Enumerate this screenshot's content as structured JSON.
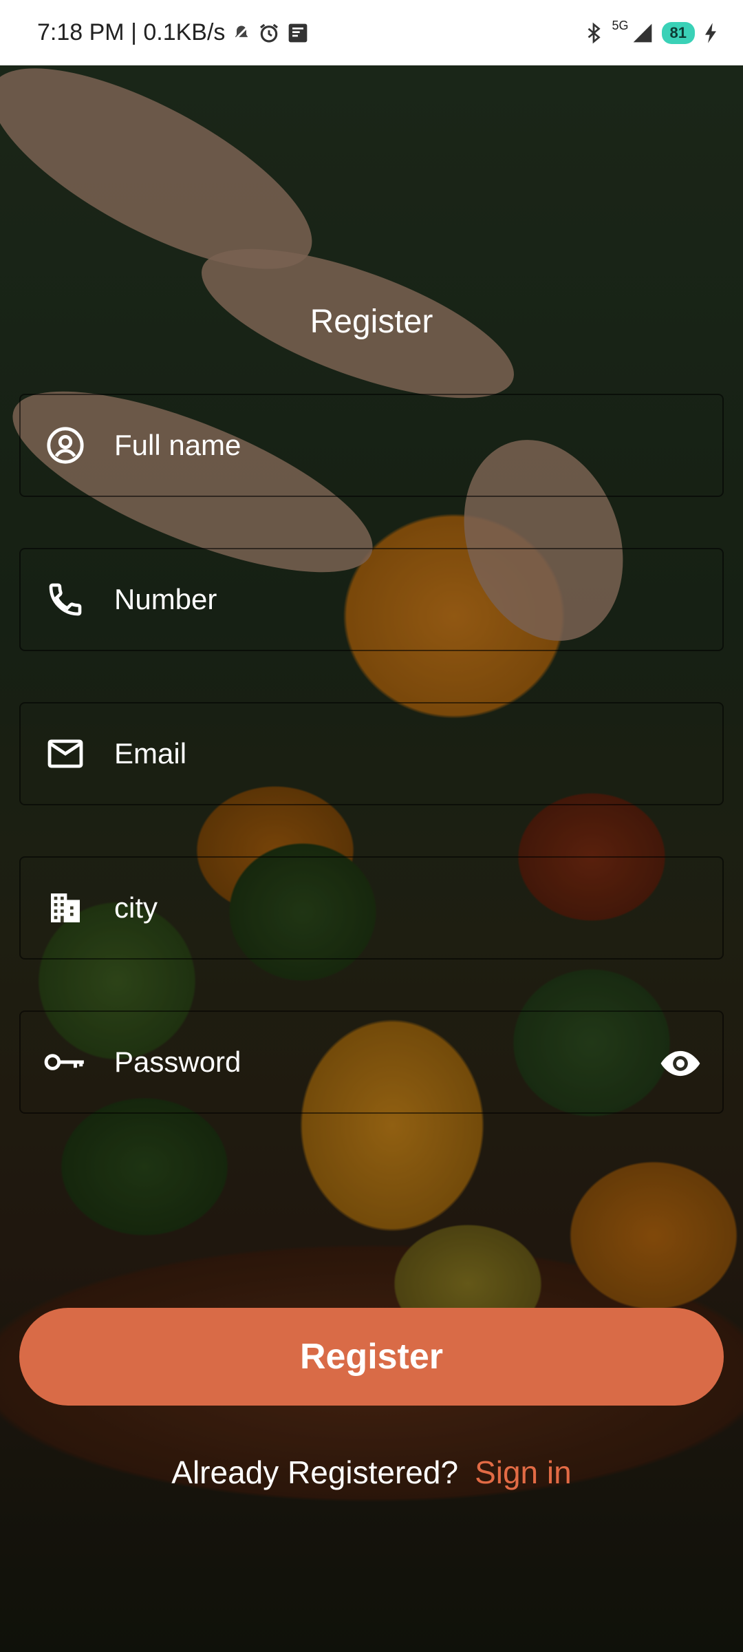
{
  "status_bar": {
    "time_speed": "7:18 PM | 0.1KB/s",
    "network": "5G",
    "battery": "81"
  },
  "title": "Register",
  "fields": [
    {
      "placeholder": "Full name",
      "icon": "person-circle-icon"
    },
    {
      "placeholder": "Number",
      "icon": "phone-icon"
    },
    {
      "placeholder": "Email",
      "icon": "mail-icon"
    },
    {
      "placeholder": "city",
      "icon": "building-icon"
    },
    {
      "placeholder": "Password",
      "icon": "key-icon",
      "toggle_icon": "eye-icon"
    }
  ],
  "register_button": "Register",
  "already_registered": "Already Registered?",
  "sign_in_link": "Sign in",
  "colors": {
    "accent": "#d96b47",
    "link": "#e26b45",
    "battery": "#3ad1b7"
  }
}
